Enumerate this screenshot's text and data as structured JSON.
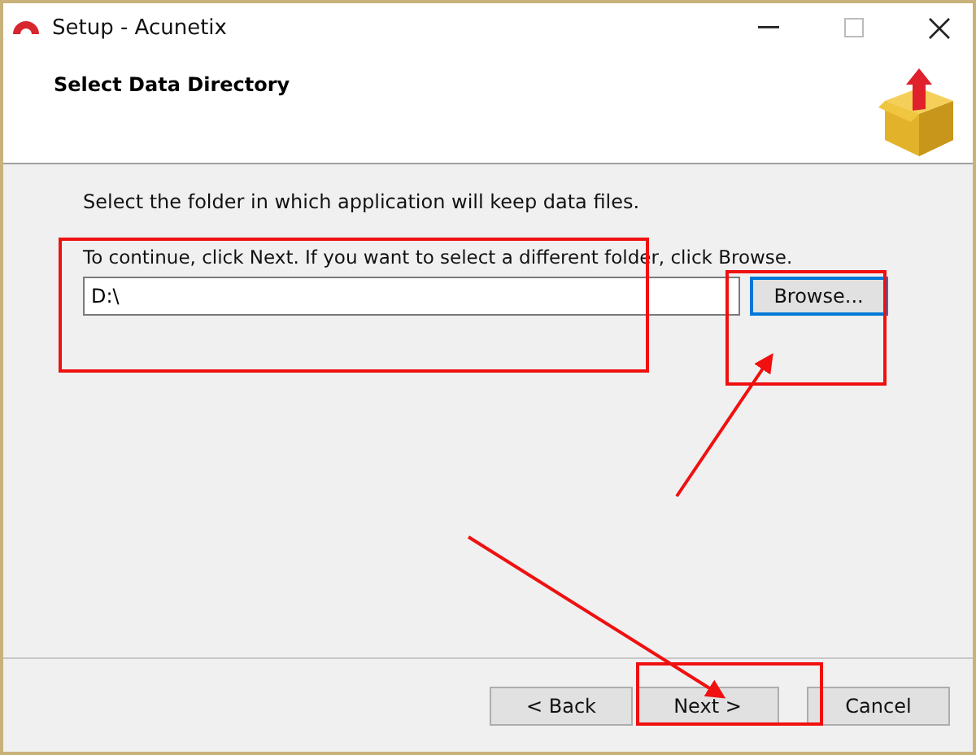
{
  "window": {
    "title": "Setup - Acunetix"
  },
  "header": {
    "title": "Select Data Directory"
  },
  "body": {
    "intro": "Select the folder in which application will keep data files.",
    "instruction": "To continue, click Next. If you want to select a different folder, click Browse.",
    "folder_field": {
      "value": "D:\\"
    },
    "browse_button": {
      "label": "Browse...",
      "focused": true
    }
  },
  "buttons": [
    {
      "label": "< Back",
      "focused": false
    },
    {
      "label": "Next >",
      "focused": false
    },
    {
      "label": "Cancel",
      "focused": false
    }
  ]
}
